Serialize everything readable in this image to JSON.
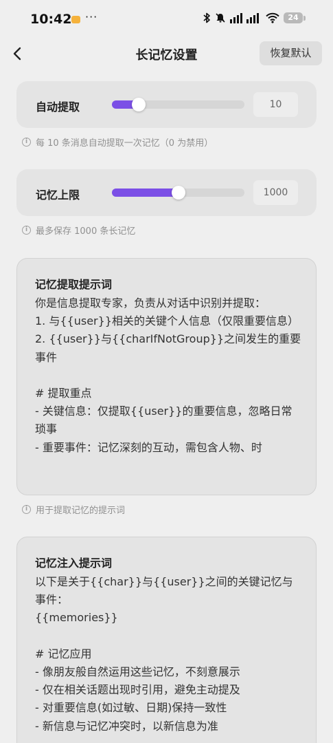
{
  "status": {
    "time": "10:42",
    "dots": "···",
    "battery": "24"
  },
  "header": {
    "title": "长记忆设置",
    "reset_label": "恢复默认"
  },
  "auto_extract": {
    "label": "自动提取",
    "value": "10",
    "slider_fraction": 0.2,
    "hint": "每 10 条消息自动提取一次记忆（0 为禁用）"
  },
  "memory_limit": {
    "label": "记忆上限",
    "value": "1000",
    "slider_fraction": 0.5,
    "hint": "最多保存 1000 条长记忆"
  },
  "extract_prompt": {
    "title": "记忆提取提示词",
    "body": "你是信息提取专家，负责从对话中识别并提取：\n1. 与{{user}}相关的关键个人信息（仅限重要信息）\n2. {{user}}与{{charIfNotGroup}}之间发生的重要事件\n\n# 提取重点\n- 关键信息：仅提取{{user}}的重要信息，忽略日常琐事\n- 重要事件：记忆深刻的互动，需包含人物、时",
    "hint": "用于提取记忆的提示词"
  },
  "inject_prompt": {
    "title": "记忆注入提示词",
    "body": "以下是关于{{char}}与{{user}}之间的关键记忆与事件：\n{{memories}}\n\n# 记忆应用\n- 像朋友般自然运用这些记忆，不刻意展示\n- 仅在相关话题出现时引用，避免主动提及\n- 对重要信息(如过敏、日期)保持一致性\n- 新信息与记忆冲突时，以新信息为准"
  },
  "colors": {
    "accent": "#7b4fe6",
    "background": "#efefef",
    "card": "#e4e4e4"
  },
  "icons": [
    "back-arrow-icon",
    "info-icon",
    "bluetooth-icon",
    "mute-bell-icon",
    "signal-icon",
    "wifi-icon",
    "battery-icon"
  ]
}
